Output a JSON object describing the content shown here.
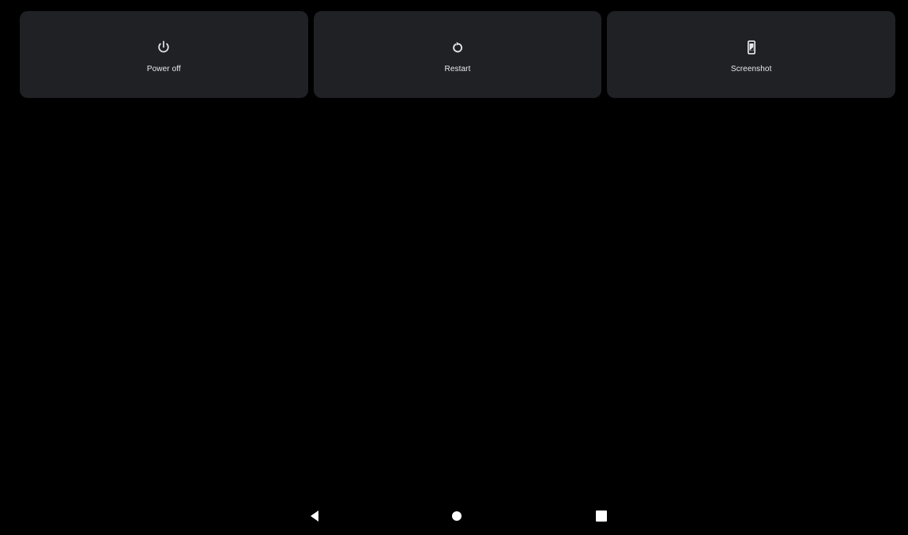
{
  "power_menu": {
    "actions": [
      {
        "label": "Power off",
        "icon": "power-icon"
      },
      {
        "label": "Restart",
        "icon": "restart-icon"
      },
      {
        "label": "Screenshot",
        "icon": "screenshot-icon"
      }
    ]
  },
  "nav_bar": {
    "buttons": [
      {
        "icon": "back-icon"
      },
      {
        "icon": "home-icon"
      },
      {
        "icon": "recents-icon"
      }
    ]
  },
  "colors": {
    "background": "#000000",
    "tile": "#202124",
    "foreground": "#e8eaed"
  }
}
